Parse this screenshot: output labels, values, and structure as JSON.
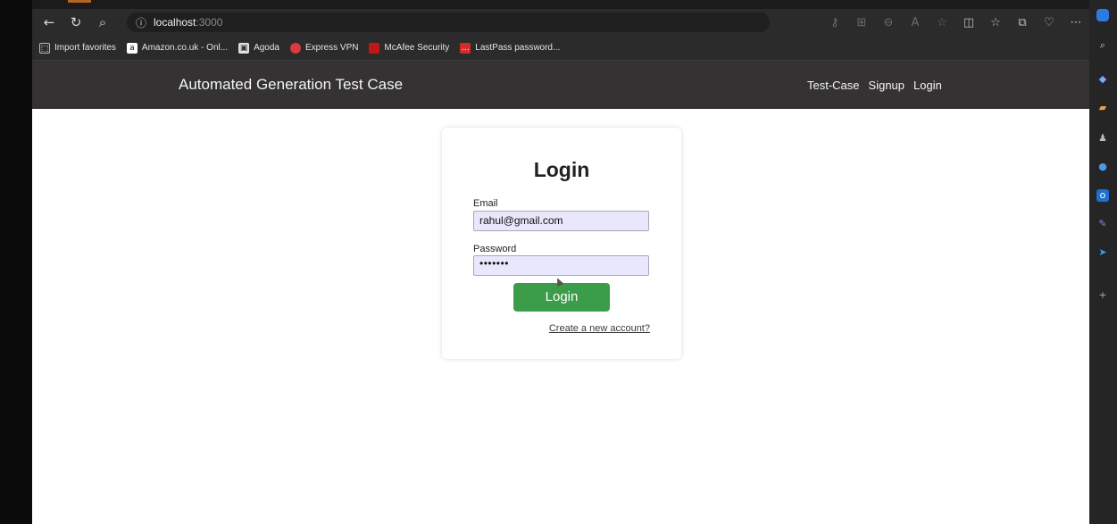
{
  "browser": {
    "url_host": "localhost",
    "url_port": ":3000",
    "nav_icons": [
      "back-icon",
      "refresh-icon",
      "search-icon"
    ],
    "toolbar_icons": [
      "key-icon",
      "apps-icon",
      "zoom-icon",
      "read-aloud-icon",
      "favorite-star-icon",
      "split-screen-icon",
      "favorites-icon",
      "collections-icon",
      "heart-icon",
      "more-icon",
      "copilot-icon"
    ]
  },
  "bookmarks": [
    {
      "label": "Import favorites",
      "icon": "import-icon",
      "color": "#2b2b2b"
    },
    {
      "label": "Amazon.co.uk - Onl...",
      "icon": "amazon-icon",
      "color": "#ffffff"
    },
    {
      "label": "Agoda",
      "icon": "agoda-icon",
      "color": "#e0e0e0"
    },
    {
      "label": "Express VPN",
      "icon": "expressvpn-icon",
      "color": "#da3940"
    },
    {
      "label": "McAfee Security",
      "icon": "mcafee-icon",
      "color": "#c01818"
    },
    {
      "label": "LastPass password...",
      "icon": "lastpass-icon",
      "color": "#d32d27"
    }
  ],
  "app": {
    "brand": "Automated Generation Test Case",
    "nav_links": [
      "Test-Case",
      "Signup",
      "Login"
    ]
  },
  "login_form": {
    "title": "Login",
    "email_label": "Email",
    "email_value": "rahul@gmail.com",
    "password_label": "Password",
    "password_value": "•••••••",
    "submit_label": "Login",
    "create_account_link": "Create a new account?"
  },
  "colors": {
    "nav_bg": "#343233",
    "button_green": "#3b9c49",
    "input_bg": "#e8e7fb"
  }
}
